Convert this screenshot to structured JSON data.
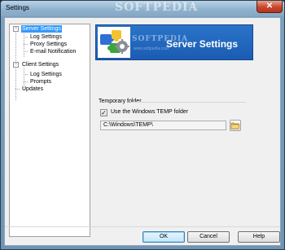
{
  "window": {
    "title": "Settings",
    "watermark": "SOFTPEDIA",
    "close_glyph": "✕"
  },
  "tree": {
    "items": [
      {
        "label": "Server Settings",
        "level": 0,
        "selected": true,
        "expanded": true
      },
      {
        "label": "Log Settings",
        "level": 1
      },
      {
        "label": "Proxy Settings",
        "level": 1
      },
      {
        "label": "E-mail Notification",
        "level": 1
      },
      {
        "label": "Client Settings",
        "level": 0,
        "expanded": true
      },
      {
        "label": "Log Settings",
        "level": 1
      },
      {
        "label": "Prompts",
        "level": 1
      },
      {
        "label": "Updates",
        "level": 0
      }
    ],
    "expander_glyph": "−"
  },
  "banner": {
    "title": "Server Settings",
    "icon": "gears-puzzle-icon",
    "watermark": "SOFTPEDIA",
    "watermark_sub": "www.softpedia.com",
    "accent": "#1f66bd"
  },
  "temp_folder": {
    "group_label": "Temporary folder",
    "use_windows_temp_label": "Use the Windows TEMP folder",
    "use_windows_temp_checked": true,
    "check_glyph": "✓",
    "path_value": "C:\\Windows\\TEMP\\",
    "browse_icon": "folder-icon"
  },
  "buttons": {
    "ok": "OK",
    "cancel": "Cancel",
    "help": "Help"
  }
}
